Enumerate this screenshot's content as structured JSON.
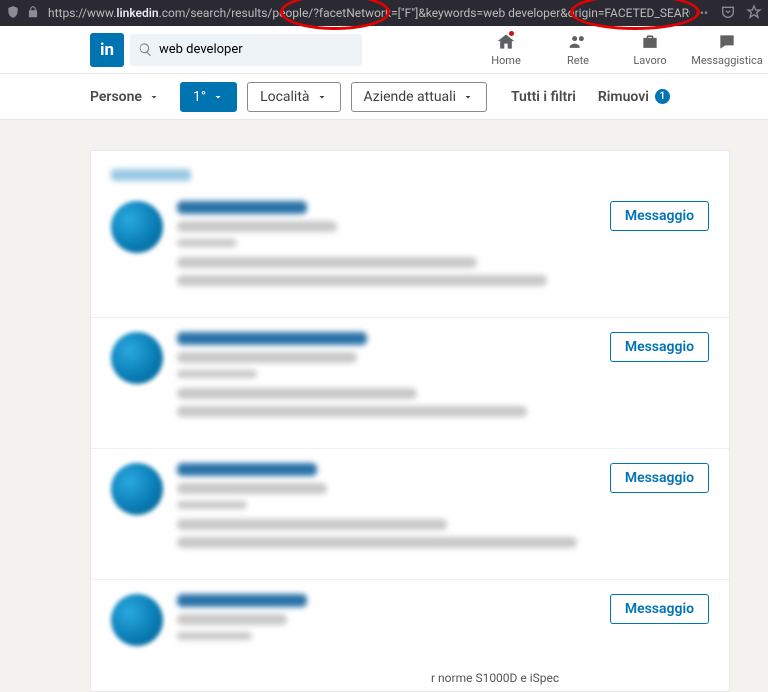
{
  "browser": {
    "url_prefix": "https://www.",
    "url_domain": "linkedin",
    "url_rest": ".com/search/results/people/?facetNetwork=[\"F\"]&keywords=web developer&origin=FACETED_SEARCH"
  },
  "search": {
    "value": "web developer"
  },
  "nav": {
    "home": "Home",
    "network": "Rete",
    "jobs": "Lavoro",
    "messaging": "Messaggistica"
  },
  "filters": {
    "people": "Persone",
    "degree": "1°",
    "location": "Località",
    "companies": "Aziende attuali",
    "all": "Tutti i filtri",
    "reset": "Rimuovi",
    "reset_count": "1"
  },
  "results": {
    "message_label": "Messaggio"
  },
  "footer": "r norme S1000D e iSpec"
}
